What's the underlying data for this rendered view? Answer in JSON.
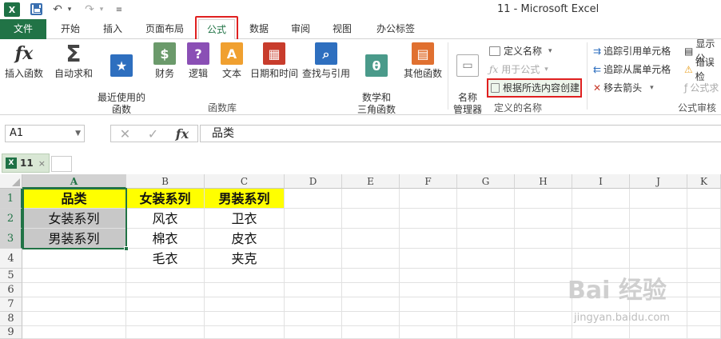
{
  "window": {
    "title": "11 - Microsoft Excel",
    "app_logo": "X",
    "quick_access": [
      "save-icon",
      "undo-icon",
      "redo-icon",
      "customize-icon"
    ]
  },
  "tabs": [
    "文件",
    "开始",
    "插入",
    "页面布局",
    "公式",
    "数据",
    "审阅",
    "视图",
    "办公标签"
  ],
  "active_tab": "公式",
  "ribbon": {
    "function_library": {
      "label": "函数库",
      "buttons": [
        {
          "label": "插入函数",
          "icon": "fx-icon"
        },
        {
          "label": "自动求和",
          "icon": "sigma-icon"
        },
        {
          "label": "最近使用的\n函数",
          "icon": "star-icon"
        },
        {
          "label": "财务",
          "icon": "coins-icon"
        },
        {
          "label": "逻辑",
          "icon": "question-icon"
        },
        {
          "label": "文本",
          "icon": "text-icon"
        },
        {
          "label": "日期和时间",
          "icon": "calendar-icon"
        },
        {
          "label": "查找与引用",
          "icon": "lookup-icon"
        },
        {
          "label": "数学和\n三角函数",
          "icon": "theta-icon"
        },
        {
          "label": "其他函数",
          "icon": "more-functions-icon"
        }
      ]
    },
    "defined_names": {
      "label": "定义的名称",
      "name_manager": "名称\n管理器",
      "define_name": "定义名称",
      "use_in_formula": "用于公式",
      "create_from_selection": "根据所选内容创建"
    },
    "formula_auditing": {
      "label": "公式审核",
      "trace_precedents": "追踪引用单元格",
      "trace_dependents": "追踪从属单元格",
      "remove_arrows": "移去箭头",
      "show_formulas": "显示公",
      "error_check": "错误检",
      "evaluate": "公式求"
    }
  },
  "formula_bar": {
    "name_box": "A1",
    "content": "品类"
  },
  "doc_tab": {
    "name": "11"
  },
  "sheet": {
    "columns": [
      "A",
      "B",
      "C",
      "D",
      "E",
      "F",
      "G",
      "H",
      "I",
      "J",
      "K"
    ],
    "rows": [
      "1",
      "2",
      "3",
      "4",
      "5",
      "6",
      "7",
      "8",
      "9"
    ],
    "cells": {
      "A1": "品类",
      "B1": "女装系列",
      "C1": "男装系列",
      "A2": "女装系列",
      "B2": "风衣",
      "C2": "卫衣",
      "A3": "男装系列",
      "B3": "棉衣",
      "C3": "皮衣",
      "B4": "毛衣",
      "C4": "夹克"
    },
    "selected_range": "A1:A3"
  },
  "watermark": {
    "text": "Bai 经验",
    "sub": "jingyan.baidu.com"
  },
  "colors": {
    "excel_green": "#217346",
    "header_fill": "#ffff00",
    "selection_fill": "#c8c8c8",
    "highlight_red": "#e02020"
  }
}
